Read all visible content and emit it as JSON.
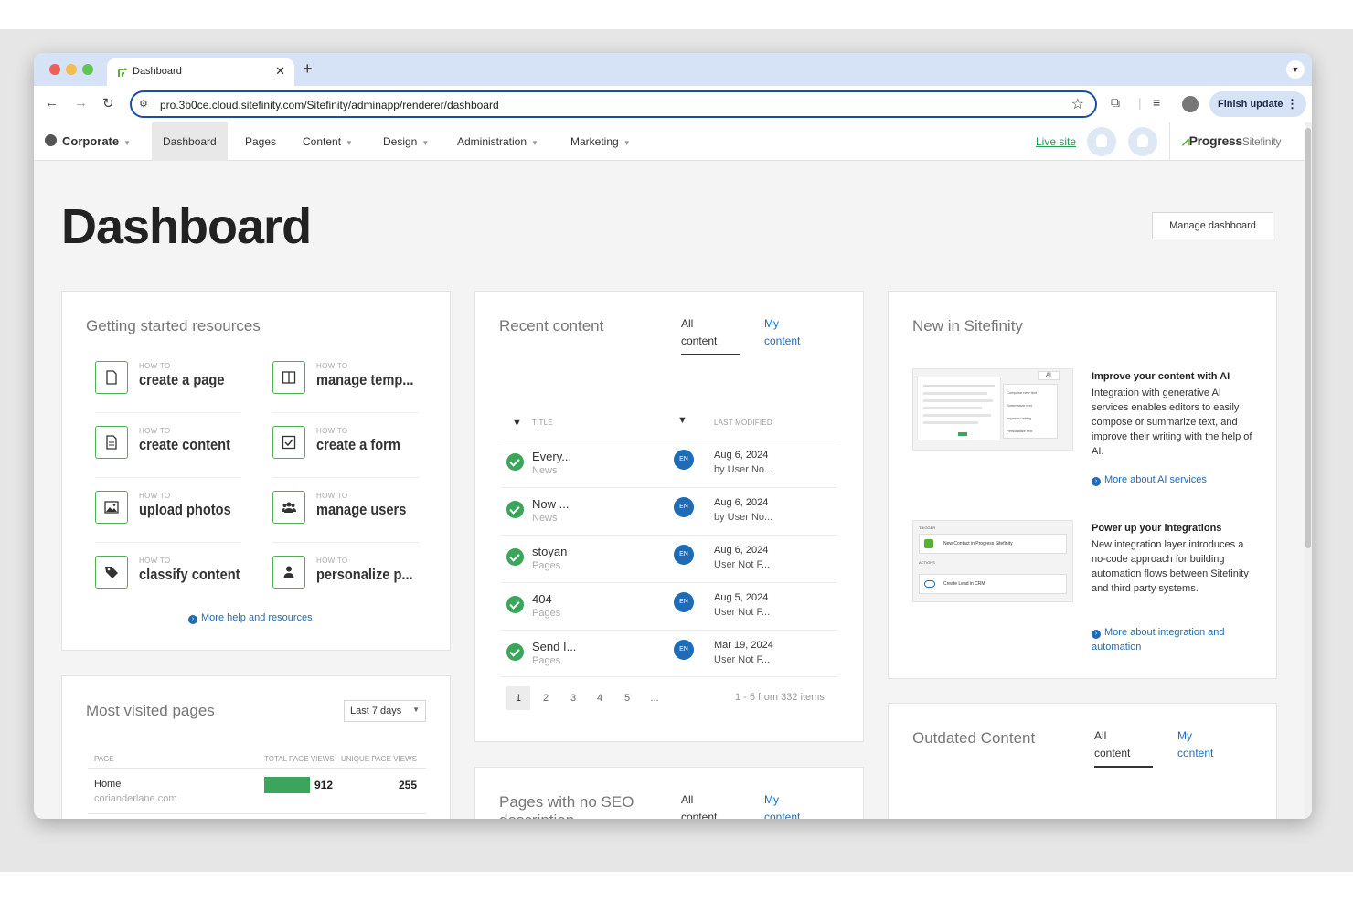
{
  "browser": {
    "tab_title": "Dashboard",
    "url": "pro.3b0ce.cloud.sitefinity.com/Sitefinity/adminapp/renderer/dashboard",
    "finish_update": "Finish update"
  },
  "appnav": {
    "site": "Corporate",
    "items": [
      "Dashboard",
      "Pages",
      "Content",
      "Design",
      "Administration",
      "Marketing"
    ],
    "live_site": "Live site",
    "brand": "Progress",
    "brand_product": "Sitefinity"
  },
  "page": {
    "title": "Dashboard",
    "manage_button": "Manage dashboard"
  },
  "getting_started": {
    "title": "Getting started resources",
    "howto_prefix": "HOW TO",
    "items": [
      {
        "label": "create a page",
        "icon": "page-icon"
      },
      {
        "label": "manage temp...",
        "icon": "template-icon"
      },
      {
        "label": "create content",
        "icon": "content-icon"
      },
      {
        "label": "create a form",
        "icon": "form-icon"
      },
      {
        "label": "upload photos",
        "icon": "photo-icon"
      },
      {
        "label": "manage users",
        "icon": "users-icon"
      },
      {
        "label": "classify content",
        "icon": "tag-icon"
      },
      {
        "label": "personalize p...",
        "icon": "person-icon"
      }
    ],
    "more_link": "More help and resources"
  },
  "recent_content": {
    "title": "Recent content",
    "tab_all": [
      "All",
      "content"
    ],
    "tab_my": [
      "My",
      "content"
    ],
    "col_title": "TITLE",
    "col_modified": "LAST MODIFIED",
    "rows": [
      {
        "title": "Every...",
        "type": "News",
        "lang": "EN",
        "date": "Aug 6, 2024",
        "by": "by User No..."
      },
      {
        "title": "Now ...",
        "type": "News",
        "lang": "EN",
        "date": "Aug 6, 2024",
        "by": "by User No..."
      },
      {
        "title": "stoyan",
        "type": "Pages",
        "lang": "EN",
        "date": "Aug 6, 2024",
        "by": "User Not F..."
      },
      {
        "title": "404",
        "type": "Pages",
        "lang": "EN",
        "date": "Aug 5, 2024",
        "by": "User Not F..."
      },
      {
        "title": "Send I...",
        "type": "Pages",
        "lang": "EN",
        "date": "Mar 19, 2024",
        "by": "User Not F..."
      }
    ],
    "pages": [
      "1",
      "2",
      "3",
      "4",
      "5",
      "..."
    ],
    "pager_info": "1 - 5 from 332 items"
  },
  "new_in_sitefinity": {
    "title": "New in Sitefinity",
    "features": [
      {
        "title": "Improve your content with AI",
        "desc": "Integration with generative AI services enables editors to easily compose or summarize text, and improve their writing with the help of AI.",
        "link": "More about AI services",
        "thumb_items": [
          "Compose new text",
          "Summarize text",
          "Improve writing",
          "Personalize text"
        ],
        "thumb_badge": "AI"
      },
      {
        "title": "Power up your integrations",
        "desc": "New integration layer introduces a no-code approach for building automation flows between Sitefinity and third party systems.",
        "link": "More about integration and automation",
        "thumb_trigger": "TRIGGER",
        "thumb_trigger_item": "New Contact in Progress Sitefinity",
        "thumb_actions": "ACTIONS",
        "thumb_action_item": "Create Lead in CRM"
      }
    ]
  },
  "most_visited": {
    "title": "Most visited pages",
    "range": "Last 7 days",
    "col_page": "PAGE",
    "col_total": "TOTAL PAGE VIEWS",
    "col_unique": "UNIQUE PAGE VIEWS",
    "rows": [
      {
        "page": "Home",
        "url": "corianderlane.com",
        "total": "912",
        "unique": "255"
      }
    ]
  },
  "seo": {
    "title": "Pages with no SEO",
    "title_cont": "description",
    "tab_all": [
      "All",
      "content"
    ],
    "tab_my": [
      "My",
      "content"
    ]
  },
  "outdated": {
    "title": "Outdated Content",
    "tab_all": [
      "All",
      "content"
    ],
    "tab_my": [
      "My",
      "content"
    ]
  },
  "colors": {
    "accent_green": "#3ba55c",
    "link_blue": "#1f6bb5",
    "browser_chrome": "#d6e2f5"
  }
}
